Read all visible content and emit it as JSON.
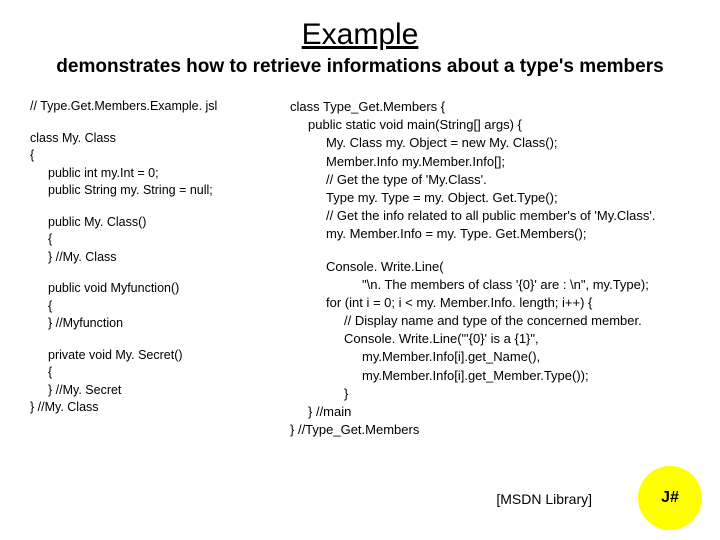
{
  "title": "Example",
  "subtitle": "demonstrates how to retrieve informations about a type's members",
  "left": {
    "l0": "// Type.Get.Members.Example. jsl",
    "l1": "class My. Class",
    "l2": "{",
    "l3": "public int my.Int = 0;",
    "l4": "public String my. String = null;",
    "l5": "public My. Class()",
    "l6": "{",
    "l7": "} //My. Class",
    "l8": "public void Myfunction()",
    "l9": "{",
    "l10": "} //Myfunction",
    "l11": "private void My. Secret()",
    "l12": "{",
    "l13": "}  //My. Secret",
    "l14": "} //My. Class"
  },
  "right": {
    "r0": "class Type_Get.Members  {",
    "r1": "public static void main(String[] args)  {",
    "r2": "My. Class my. Object = new My. Class();",
    "r3": "Member.Info my.Member.Info[];",
    "r4": "// Get the type of 'My.Class'.",
    "r5": "Type my. Type = my. Object. Get.Type();",
    "r6": "// Get the info related to all public member's of 'My.Class'.",
    "r7": "my. Member.Info = my. Type. Get.Members();",
    "r8": "Console. Write.Line(",
    "r9": "\"\\n. The members of class '{0}' are : \\n\", my.Type);",
    "r10": "for (int i = 0; i < my. Member.Info. length; i++) {",
    "r11": "// Display name and type of the concerned member.",
    "r12": "Console. Write.Line(\"'{0}' is a {1}\",",
    "r13": "my.Member.Info[i].get_Name(),",
    "r14": "my.Member.Info[i].get_Member.Type());",
    "r15": "}",
    "r16": "} //main",
    "r17": "} //Type_Get.Members"
  },
  "msdn": "[MSDN Library]",
  "badge": "J#"
}
